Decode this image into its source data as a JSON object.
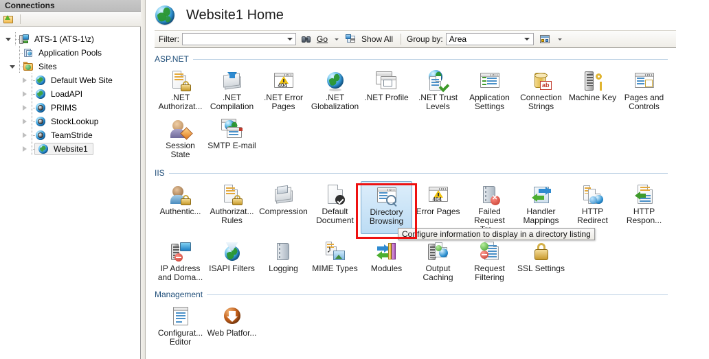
{
  "connections": {
    "header": "Connections",
    "toolbar": [
      {
        "name": "connect-to-server-icon",
        "label": ""
      }
    ],
    "tree": [
      {
        "label": "ATS-1 (ATS-1\\z)",
        "icon": "server-icon",
        "expander": "open",
        "depth": 0,
        "selected": false
      },
      {
        "label": "Application Pools",
        "icon": "application-pools-icon",
        "expander": "none",
        "depth": 1,
        "selected": false
      },
      {
        "label": "Sites",
        "icon": "sites-folder-icon",
        "expander": "open",
        "depth": 1,
        "selected": false
      },
      {
        "label": "Default Web Site",
        "icon": "website-icon",
        "expander": "closed",
        "depth": 2,
        "selected": false
      },
      {
        "label": "LoadAPI",
        "icon": "website-icon",
        "expander": "closed",
        "depth": 2,
        "selected": false
      },
      {
        "label": "PRIMS",
        "icon": "website-stopped-icon",
        "expander": "closed",
        "depth": 2,
        "selected": false
      },
      {
        "label": "StockLookup",
        "icon": "website-stopped-icon",
        "expander": "closed",
        "depth": 2,
        "selected": false
      },
      {
        "label": "TeamStride",
        "icon": "website-stopped-icon",
        "expander": "closed",
        "depth": 2,
        "selected": false
      },
      {
        "label": "Website1",
        "icon": "website-icon",
        "expander": "closed",
        "depth": 2,
        "selected": true
      }
    ]
  },
  "page": {
    "title": "Website1 Home",
    "icon": "website-globe-icon"
  },
  "filter_bar": {
    "filter_label": "Filter:",
    "filter_value": "",
    "filter_placeholder": "",
    "go_label": "Go",
    "show_all_label": "Show All",
    "group_by_label": "Group by:",
    "group_by_value": "Area",
    "view_icon": "view-options-icon"
  },
  "sections": [
    {
      "title": "ASP.NET",
      "tiles": [
        {
          "label": ".NET Authorizat...",
          "icon": "net-authorization-rules-icon",
          "selected": false
        },
        {
          "label": ".NET Compilation",
          "icon": "net-compilation-icon",
          "selected": false
        },
        {
          "label": ".NET Error Pages",
          "icon": "net-error-pages-icon",
          "selected": false
        },
        {
          "label": ".NET Globalization",
          "icon": "net-globalization-icon",
          "selected": false
        },
        {
          "label": ".NET Profile",
          "icon": "net-profile-icon",
          "selected": false
        },
        {
          "label": ".NET Trust Levels",
          "icon": "net-trust-levels-icon",
          "selected": false
        },
        {
          "label": "Application Settings",
          "icon": "application-settings-icon",
          "selected": false
        },
        {
          "label": "Connection Strings",
          "icon": "connection-strings-icon",
          "selected": false
        },
        {
          "label": "Machine Key",
          "icon": "machine-key-icon",
          "selected": false
        },
        {
          "label": "Pages and Controls",
          "icon": "pages-and-controls-icon",
          "selected": false
        },
        {
          "label": "Session State",
          "icon": "session-state-icon",
          "selected": false
        },
        {
          "label": "SMTP E-mail",
          "icon": "smtp-email-icon",
          "selected": false
        }
      ]
    },
    {
      "title": "IIS",
      "tiles": [
        {
          "label": "Authentic...",
          "icon": "authentication-icon",
          "selected": false
        },
        {
          "label": "Authorizat... Rules",
          "icon": "authorization-rules-icon",
          "selected": false
        },
        {
          "label": "Compression",
          "icon": "compression-icon",
          "selected": false
        },
        {
          "label": "Default Document",
          "icon": "default-document-icon",
          "selected": false
        },
        {
          "label": "Directory Browsing",
          "icon": "directory-browsing-icon",
          "selected": true
        },
        {
          "label": "Error Pages",
          "icon": "error-pages-icon",
          "selected": false
        },
        {
          "label": "Failed Request Tra...",
          "icon": "failed-request-tracing-icon",
          "selected": false
        },
        {
          "label": "Handler Mappings",
          "icon": "handler-mappings-icon",
          "selected": false
        },
        {
          "label": "HTTP Redirect",
          "icon": "http-redirect-icon",
          "selected": false
        },
        {
          "label": "HTTP Respon...",
          "icon": "http-response-headers-icon",
          "selected": false
        },
        {
          "label": "IP Address and Doma...",
          "icon": "ip-address-domain-restrictions-icon",
          "selected": false
        },
        {
          "label": "ISAPI Filters",
          "icon": "isapi-filters-icon",
          "selected": false
        },
        {
          "label": "Logging",
          "icon": "logging-icon",
          "selected": false
        },
        {
          "label": "MIME Types",
          "icon": "mime-types-icon",
          "selected": false
        },
        {
          "label": "Modules",
          "icon": "modules-icon",
          "selected": false
        },
        {
          "label": "Output Caching",
          "icon": "output-caching-icon",
          "selected": false
        },
        {
          "label": "Request Filtering",
          "icon": "request-filtering-icon",
          "selected": false
        },
        {
          "label": "SSL Settings",
          "icon": "ssl-settings-icon",
          "selected": false
        }
      ]
    },
    {
      "title": "Management",
      "tiles": [
        {
          "label": "Configurat... Editor",
          "icon": "configuration-editor-icon",
          "selected": false
        },
        {
          "label": "Web Platfor...",
          "icon": "web-platform-installer-icon",
          "selected": false
        }
      ]
    }
  ],
  "tooltip": {
    "text": "Configure information to display in a directory listing"
  },
  "highlight": {
    "target": "Directory Browsing",
    "color": "#ee1111"
  },
  "colors": {
    "section_title": "#1f4e79",
    "selection_bg": "#bcdcf4",
    "highlight_red": "#ee1111"
  }
}
